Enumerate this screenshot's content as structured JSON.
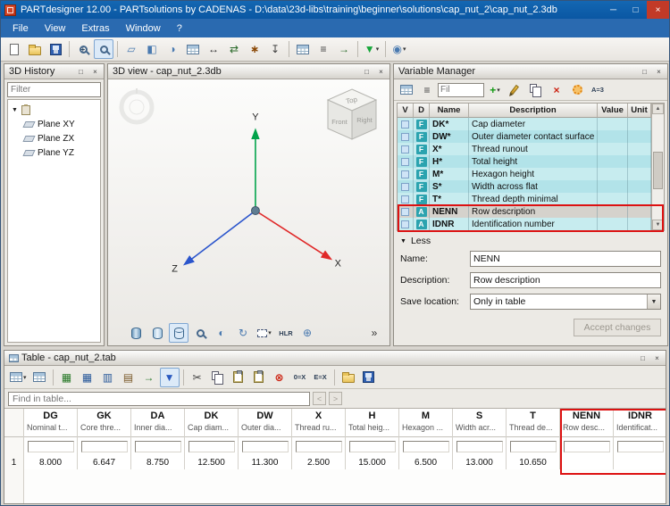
{
  "window": {
    "title": "PARTdesigner 12.00 - PARTsolutions by CADENAS - D:\\data\\23d-libs\\training\\beginner\\solutions\\cap_nut_2\\cap_nut_2.3db",
    "controls": {
      "minimize": "─",
      "maximize": "□",
      "close": "×"
    }
  },
  "panel_controls": {
    "float": "□",
    "close": "×"
  },
  "menubar": {
    "items": [
      "File",
      "View",
      "Extras",
      "Window",
      "?"
    ]
  },
  "toolbar": {
    "buttons": [
      {
        "name": "new-document-button",
        "icon": "new-document-icon",
        "shape": "page"
      },
      {
        "name": "open-button",
        "icon": "open-folder-icon",
        "shape": "folder"
      },
      {
        "name": "save-button",
        "icon": "save-icon",
        "shape": "save"
      },
      {
        "sep": true
      },
      {
        "name": "zoom-in-button",
        "icon": "magnifier-plus-icon",
        "shape": "magnifier plus"
      },
      {
        "name": "zoom-window-button",
        "icon": "magnifier-icon",
        "shape": "magnifier",
        "pressed": true
      },
      {
        "sep": true
      },
      {
        "name": "sketch-button",
        "icon": "sketch-plane-icon",
        "glyph": "▱",
        "color": "#4a7ab0"
      },
      {
        "name": "extrude-button",
        "icon": "extrude-icon",
        "glyph": "◧",
        "color": "#4a7ab0"
      },
      {
        "name": "revolve-button",
        "icon": "revolve-icon",
        "glyph": "◑",
        "color": "#4a7ab0"
      },
      {
        "name": "variable-table-button",
        "icon": "table-grid-icon",
        "shape": "grid"
      },
      {
        "name": "dimension-button",
        "icon": "dimension-icon",
        "glyph": "↔",
        "color": "#333333"
      },
      {
        "name": "exchange-button",
        "icon": "exchange-icon",
        "glyph": "⇄",
        "color": "#2a6a2a"
      },
      {
        "name": "tools-button",
        "icon": "tools-icon",
        "glyph": "∗",
        "color": "#884400",
        "bold": true
      },
      {
        "name": "attach-button",
        "icon": "anchor-icon",
        "glyph": "↧",
        "color": "#444444"
      },
      {
        "sep": true
      },
      {
        "name": "part-table-button",
        "icon": "grid-icon",
        "shape": "grid"
      },
      {
        "name": "list-view-button",
        "icon": "list-icon",
        "glyph": "≡",
        "color": "#444444"
      },
      {
        "name": "export-button",
        "icon": "export-arrow-icon",
        "glyph": "→",
        "color": "#2a6a2a",
        "bold": true
      },
      {
        "sep": true
      },
      {
        "name": "quick-start-button",
        "icon": "green-triangle-icon",
        "glyph": "▼",
        "color": "#17a63a",
        "bold": true,
        "dd": true
      },
      {
        "sep": true
      },
      {
        "name": "connection-button",
        "icon": "connector-icon",
        "glyph": "◉",
        "color": "#4a7ab0",
        "dd": true
      }
    ]
  },
  "history": {
    "title": "3D History",
    "filter_placeholder": "Filter",
    "root_caret": "▼",
    "items": [
      "Plane XY",
      "Plane ZX",
      "Plane YZ"
    ]
  },
  "view3d": {
    "title": "3D view - cap_nut_2.3db",
    "axes": {
      "x": "X",
      "y": "Y",
      "z": "Z"
    },
    "cube": {
      "top": "Top",
      "front": "Front",
      "right": "Right"
    },
    "tools": [
      {
        "name": "display-solid-button",
        "icon": "cylinder-solid-icon",
        "shape": "cyl"
      },
      {
        "name": "display-shaded-button",
        "icon": "cylinder-shaded-icon",
        "shape": "cyl light"
      },
      {
        "name": "display-wireframe-button",
        "icon": "cylinder-wire-icon",
        "shape": "cyl wire",
        "pressed": true
      },
      {
        "name": "zoom-fit-button",
        "icon": "magnifier-icon",
        "shape": "magnifier"
      },
      {
        "name": "shading-button",
        "icon": "half-sphere-icon",
        "glyph": "◐",
        "color": "#4a7ab0"
      },
      {
        "name": "rotate-view-button",
        "icon": "rotate-icon",
        "glyph": "↻",
        "color": "#4a7ab0"
      },
      {
        "name": "selection-mode-button",
        "icon": "selection-box-icon",
        "shape": "selbox",
        "dd": true
      },
      {
        "name": "hidden-line-button",
        "icon": "hidden-line-icon",
        "text": "HLR"
      },
      {
        "name": "mesh-display-button",
        "icon": "mesh-sphere-icon",
        "glyph": "⊕",
        "color": "#4a7ab0"
      },
      {
        "name": "more-display-options-button",
        "icon": "overflow-icon",
        "glyph": "»",
        "color": "#333333",
        "spring": true
      }
    ]
  },
  "varmgr": {
    "title": "Variable Manager",
    "filter_placeholder": "Fil",
    "toolbar": [
      {
        "name": "variables-grid-view-button",
        "icon": "grid-icon",
        "shape": "grid"
      },
      {
        "name": "variables-list-view-button",
        "icon": "list-icon",
        "glyph": "≡",
        "color": "#444444"
      },
      {
        "input": true
      },
      {
        "name": "add-variable-button",
        "icon": "plus-icon",
        "glyph": "+",
        "color": "#149a14",
        "bold": true,
        "dd": true
      },
      {
        "name": "edit-variable-button",
        "icon": "pencil-icon",
        "shape": "pencil"
      },
      {
        "name": "copy-variable-button",
        "icon": "copy-icon",
        "shape": "copy"
      },
      {
        "name": "delete-variable-button",
        "icon": "red-x-icon",
        "glyph": "×",
        "color": "#cc2211",
        "bold": true
      },
      {
        "name": "variable-settings-button",
        "icon": "gear-icon",
        "shape": "gear"
      },
      {
        "name": "auto-dimension-button",
        "icon": "a-equals-icon",
        "text": "A=3"
      }
    ],
    "columns": [
      "V",
      "D",
      "Name",
      "Description",
      "Value",
      "Unit"
    ],
    "rows": [
      {
        "d": "F",
        "name": "DK*",
        "description": "Cap diameter"
      },
      {
        "d": "F",
        "name": "DW*",
        "description": "Outer diameter contact surface"
      },
      {
        "d": "F",
        "name": "X*",
        "description": "Thread runout"
      },
      {
        "d": "F",
        "name": "H*",
        "description": "Total height"
      },
      {
        "d": "F",
        "name": "M*",
        "description": "Hexagon height"
      },
      {
        "d": "F",
        "name": "S*",
        "description": "Width across flat"
      },
      {
        "d": "F",
        "name": "T*",
        "description": "Thread depth minimal"
      },
      {
        "d": "A",
        "name": "NENN",
        "description": "Row description",
        "selected": true
      },
      {
        "d": "A",
        "name": "IDNR",
        "description": "Identification number"
      }
    ],
    "less_icon": "▼",
    "less_label": "Less",
    "form": {
      "name_label": "Name:",
      "name_value": "NENN",
      "description_label": "Description:",
      "description_value": "Row description",
      "save_location_label": "Save location:",
      "save_location_value": "Only in table",
      "accept_label": "Accept changes"
    }
  },
  "table": {
    "title": "Table - cap_nut_2.tab",
    "find_placeholder": "Find in table...",
    "nav_prev": "<",
    "nav_next": ">",
    "row_number": "1",
    "toolbar": [
      {
        "name": "table-options-button",
        "icon": "grid-icon",
        "shape": "grid",
        "dd": true
      },
      {
        "name": "table-generate-button",
        "icon": "grid-blue-icon",
        "shape": "grid"
      },
      {
        "sep": true
      },
      {
        "name": "insert-row-above-button",
        "icon": "row-above-icon",
        "glyph": "▦",
        "color": "#2a7a2a"
      },
      {
        "name": "insert-row-below-button",
        "icon": "row-below-icon",
        "glyph": "▦",
        "color": "#2a5a9a"
      },
      {
        "name": "insert-column-button",
        "icon": "column-insert-icon",
        "glyph": "▥",
        "color": "#2a5a9a"
      },
      {
        "name": "row-operations-button",
        "icon": "rows-icon",
        "glyph": "▤",
        "color": "#7a5a2a"
      },
      {
        "name": "transfer-button",
        "icon": "right-arrow-icon",
        "glyph": "→",
        "color": "#2a7a2a",
        "bold": true
      },
      {
        "name": "sort-descending-button",
        "icon": "blue-down-arrow-icon",
        "glyph": "▼",
        "color": "#2a5ac0",
        "bold": true,
        "pressed": true
      },
      {
        "sep": true
      },
      {
        "name": "cut-button",
        "icon": "scissors-icon",
        "glyph": "✂",
        "color": "#444444"
      },
      {
        "name": "copy-button",
        "icon": "copy-icon",
        "shape": "copy"
      },
      {
        "name": "paste-button",
        "icon": "clipboard-icon",
        "shape": "clipboard"
      },
      {
        "name": "paste-special-button",
        "icon": "clipboard-plus-icon",
        "shape": "clipboard"
      },
      {
        "name": "delete-cells-button",
        "icon": "red-circle-x-icon",
        "glyph": "⊗",
        "color": "#cc2211",
        "bold": true
      },
      {
        "name": "zero-value-check-button",
        "icon": "zero-x-icon",
        "text": "0=X"
      },
      {
        "name": "expression-check-button",
        "icon": "e-x-icon",
        "text": "E=X"
      },
      {
        "sep": true
      },
      {
        "name": "open-table-button",
        "icon": "open-folder-icon",
        "shape": "folder"
      },
      {
        "name": "save-table-button",
        "icon": "save-icon",
        "shape": "save"
      }
    ],
    "columns": [
      {
        "code": "DG",
        "desc": "Nominal t...",
        "value": "8.000"
      },
      {
        "code": "GK",
        "desc": "Core thre...",
        "value": "6.647"
      },
      {
        "code": "DA",
        "desc": "Inner dia...",
        "value": "8.750"
      },
      {
        "code": "DK",
        "desc": "Cap diam...",
        "value": "12.500"
      },
      {
        "code": "DW",
        "desc": "Outer dia...",
        "value": "11.300"
      },
      {
        "code": "X",
        "desc": "Thread ru...",
        "value": "2.500"
      },
      {
        "code": "H",
        "desc": "Total heig...",
        "value": "15.000"
      },
      {
        "code": "M",
        "desc": "Hexagon ...",
        "value": "6.500"
      },
      {
        "code": "S",
        "desc": "Width acr...",
        "value": "13.000"
      },
      {
        "code": "T",
        "desc": "Thread de...",
        "value": "10.650"
      },
      {
        "code": "NENN",
        "desc": "Row desc...",
        "value": ""
      },
      {
        "code": "IDNR",
        "desc": "Identificat...",
        "value": ""
      }
    ]
  },
  "colors": {
    "highlight_red": "#dd1111",
    "accent_blue": "#0a57a3",
    "row_cyan": "#bfe8ec",
    "badge_teal": "#2ba3af",
    "axis_x": "#e02828",
    "axis_y": "#00a34a",
    "axis_z": "#2b55cc"
  }
}
